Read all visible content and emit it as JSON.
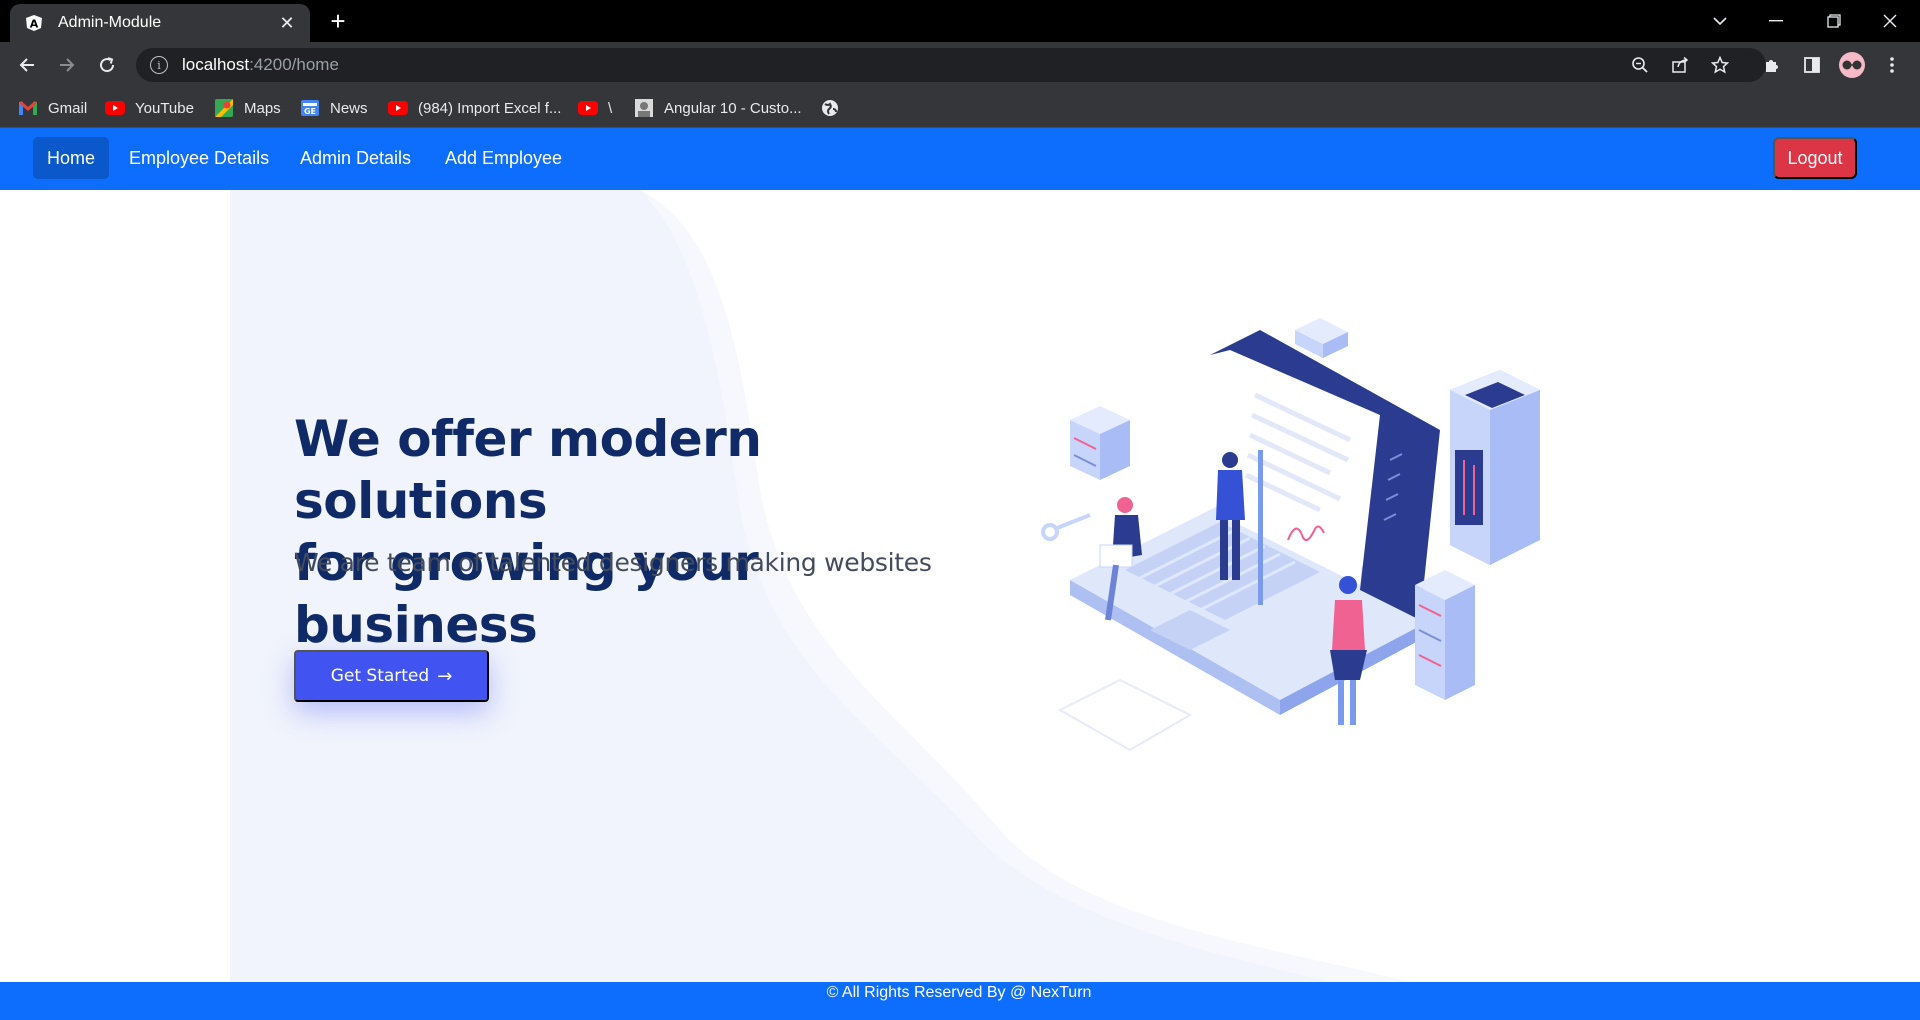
{
  "browser": {
    "tab_title": "Admin-Module",
    "url_host": "localhost",
    "url_path": ":4200/home",
    "bookmarks": [
      {
        "label": "Gmail",
        "icon": "gmail-icon"
      },
      {
        "label": "YouTube",
        "icon": "youtube-icon"
      },
      {
        "label": "Maps",
        "icon": "maps-icon"
      },
      {
        "label": "News",
        "icon": "news-icon"
      },
      {
        "label": "(984) Import Excel f...",
        "icon": "youtube-icon"
      },
      {
        "label": "\\",
        "icon": "youtube-icon"
      },
      {
        "label": "Angular 10 - Custo...",
        "icon": "page-thumbnail-icon"
      },
      {
        "label": "",
        "icon": "globe-icon"
      }
    ]
  },
  "navbar": {
    "links": [
      "Home",
      "Employee Details",
      "Admin Details",
      "Add Employee"
    ],
    "active": "Home",
    "logout_label": "Logout",
    "bg_color": "#0d6efd",
    "logout_color": "#dc3545"
  },
  "hero": {
    "title_line1": "We offer modern solutions",
    "title_line2": "for growing your business",
    "subtitle": "We are team of talented designers making websites",
    "cta_label": "Get Started",
    "cta_color": "#4154f1",
    "title_color": "#0f2a66"
  },
  "footer": {
    "text": "© All Rights Reserved By @ NexTurn"
  }
}
